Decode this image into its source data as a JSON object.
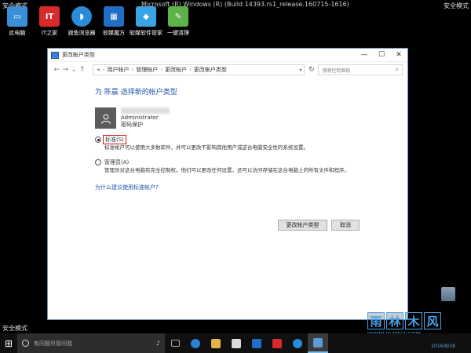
{
  "desktop": {
    "safe_mode_tl": "安全模式",
    "safe_mode_tr": "安全模式",
    "safe_mode_bl": "安全模式",
    "build_text": "Microsoft (R) Windows (R) (Build 14393.rs1_release.160715-1616)",
    "icons": [
      {
        "label": "此电脑",
        "glyph": "▭",
        "color": "#3b8fd9",
        "icon": "computer-icon"
      },
      {
        "label": "IT之家",
        "glyph": "IT",
        "color": "#d82a2a",
        "icon": "ithome-icon"
      },
      {
        "label": "旗鱼浏览器",
        "glyph": "◗",
        "color": "#2a8cd8",
        "icon": "browser-icon"
      },
      {
        "label": "软媒魔方",
        "glyph": "▦",
        "color": "#1f6fc6",
        "icon": "cube-icon"
      },
      {
        "label": "软媒软件管家",
        "glyph": "◆",
        "color": "#3aa3e3",
        "icon": "software-manager-icon"
      },
      {
        "label": "一键清理",
        "glyph": "✎",
        "color": "#5fb24a",
        "icon": "cleanup-icon"
      }
    ]
  },
  "window": {
    "title": "更改帐户类型",
    "controls": {
      "minimize": "—",
      "maximize": "☐",
      "close": "✕"
    },
    "nav": {
      "back": "←",
      "forward": "→",
      "up": "↑",
      "dropdown": "⌄",
      "refresh": "↻"
    },
    "breadcrumb": [
      "«",
      "用户帐户",
      "管理帐户",
      "更改帐户",
      "更改帐户类型"
    ],
    "search_placeholder": "搜索控制面板",
    "heading": "为 陈晨 选择新的帐户类型",
    "account": {
      "role": "Administrator",
      "status": "密码保护"
    },
    "options": [
      {
        "label": "标准(S)",
        "checked": true,
        "description": "标准帐户可以使用大多数软件，并可以更改不影响其他用户或这台电脑安全性的系统设置。"
      },
      {
        "label": "管理员(A)",
        "checked": false,
        "description": "管理员对这台电脑有完全控制权。他们可以更改任何设置，还可以访问存储在这台电脑上的所有文件和程序。"
      }
    ],
    "help_link": "为什么建议使用标准帐户?",
    "buttons": {
      "change": "更改帐户类型",
      "cancel": "取消"
    }
  },
  "taskbar": {
    "start_glyph": "⊞",
    "search_placeholder": "有问题尽管问我",
    "mic_glyph": "🎤",
    "clock": "2016/8/18",
    "icons": [
      {
        "name": "task-view-icon",
        "color": "#888"
      },
      {
        "name": "edge-icon",
        "color": "#2b7fd4"
      },
      {
        "name": "file-explorer-icon",
        "color": "#e3b448"
      },
      {
        "name": "store-icon",
        "color": "#ddd"
      },
      {
        "name": "cube-icon",
        "color": "#1f6fc6"
      },
      {
        "name": "ithome-icon",
        "color": "#d82a2a"
      },
      {
        "name": "browser-icon",
        "color": "#2a8cd8"
      },
      {
        "name": "control-panel-icon",
        "color": "#5b9bd5"
      }
    ]
  },
  "watermark": {
    "letters": [
      "雨",
      "林",
      "木",
      "风"
    ],
    "url": "WWW.YLMFU.COM"
  }
}
